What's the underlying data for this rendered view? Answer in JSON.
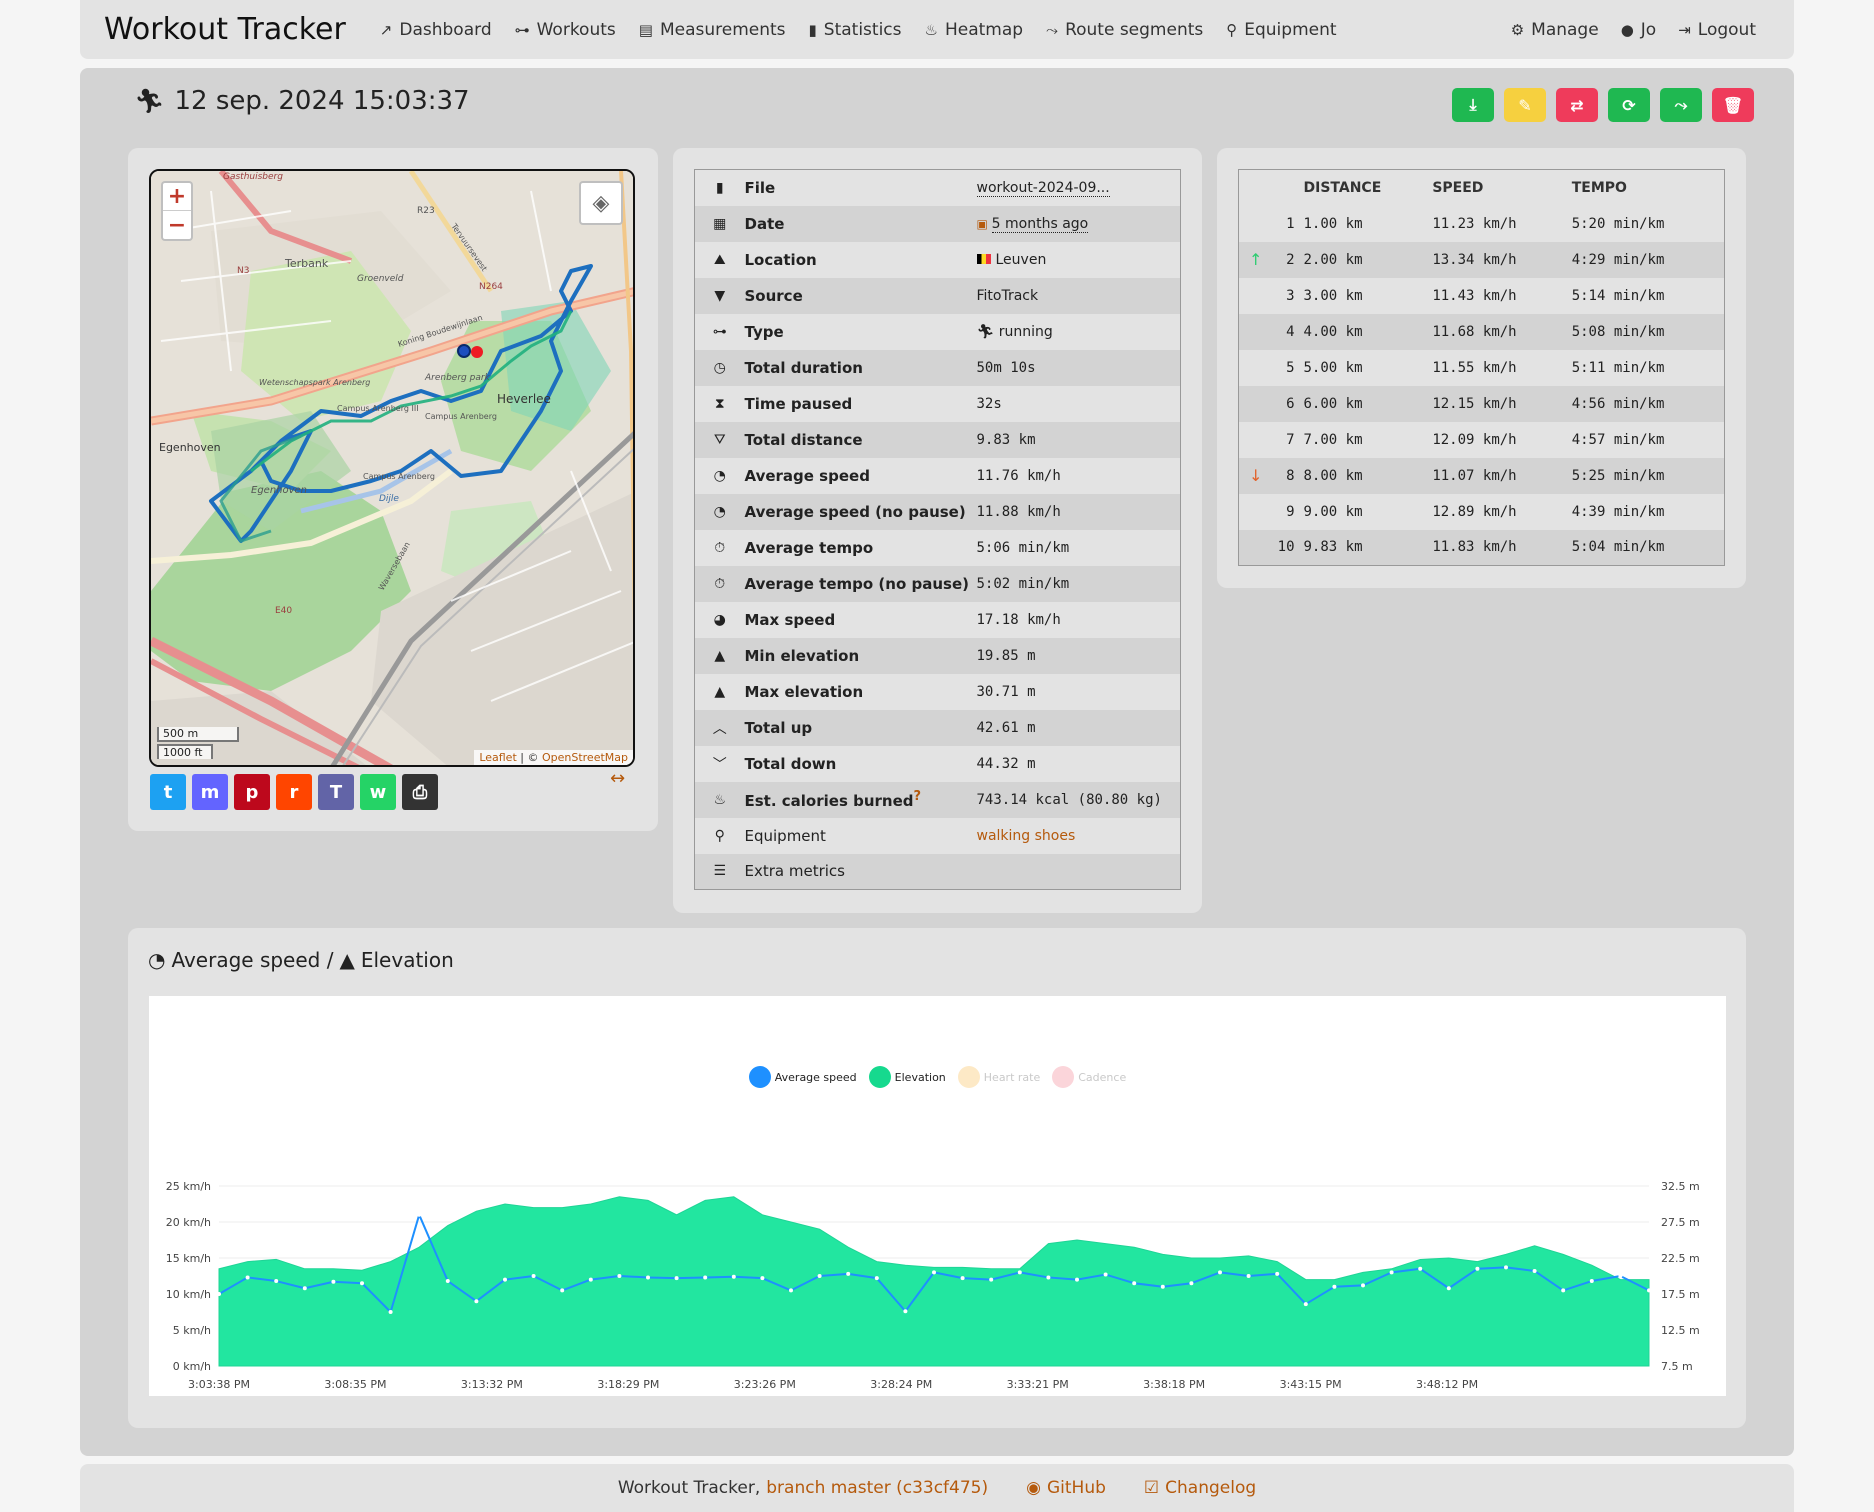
{
  "navbar": {
    "brand": "Workout Tracker",
    "items": [
      {
        "label": "Dashboard",
        "icon": "chart-line-icon"
      },
      {
        "label": "Workouts",
        "icon": "dumbbell-icon"
      },
      {
        "label": "Measurements",
        "icon": "weight-icon"
      },
      {
        "label": "Statistics",
        "icon": "bar-chart-icon"
      },
      {
        "label": "Heatmap",
        "icon": "fire-icon"
      },
      {
        "label": "Route segments",
        "icon": "route-icon"
      },
      {
        "label": "Equipment",
        "icon": "bicycle-icon"
      }
    ],
    "right": [
      {
        "label": "Manage",
        "icon": "gear-icon"
      },
      {
        "label": "Jo",
        "icon": "user-icon"
      },
      {
        "label": "Logout",
        "icon": "logout-icon"
      }
    ]
  },
  "workout": {
    "title": "12 sep. 2024 15:03:37",
    "actions": [
      {
        "name": "download",
        "color": "#1fb851"
      },
      {
        "name": "edit",
        "color": "#f6d03f"
      },
      {
        "name": "repeat",
        "color": "#ef3b5b"
      },
      {
        "name": "refresh",
        "color": "#1fb851"
      },
      {
        "name": "route-segment",
        "color": "#1fb851"
      },
      {
        "name": "delete",
        "color": "#ef3b5b"
      }
    ]
  },
  "map": {
    "zoom_in": "+",
    "zoom_out": "−",
    "scale_metric": "500 m",
    "scale_imperial": "1000 ft",
    "attribution_leaflet": "Leaflet",
    "attribution_sep": " | © ",
    "attribution_osm": "OpenStreetMap",
    "labels": [
      "Gasthuisberg",
      "Terbank",
      "Groenveld",
      "N3",
      "R23",
      "N264",
      "Tervuursevest",
      "Koning Boudewijnlaan",
      "Wetenschapspark Arenberg",
      "Arenberg park",
      "Campus Arenberg III",
      "Campus Arenberg",
      "Heverlee",
      "Egenhoven",
      "Egenhoven",
      "Campus Arenberg",
      "E40",
      "Waversebaan",
      "Dijle"
    ]
  },
  "share": [
    {
      "name": "twitter",
      "glyph": "t",
      "color": "#1da1f2"
    },
    {
      "name": "mastodon",
      "glyph": "m",
      "color": "#6364ff"
    },
    {
      "name": "pinterest",
      "glyph": "p",
      "color": "#bd081c"
    },
    {
      "name": "reddit",
      "glyph": "r",
      "color": "#ff4500"
    },
    {
      "name": "teams",
      "glyph": "T",
      "color": "#6264a7"
    },
    {
      "name": "whatsapp",
      "glyph": "w",
      "color": "#25d366"
    },
    {
      "name": "print",
      "glyph": "⎙",
      "color": "#333333"
    }
  ],
  "details": [
    {
      "icon": "file-icon",
      "label": "File",
      "value": "workout-2024-09...",
      "style": "dotted"
    },
    {
      "icon": "calendar-icon",
      "label": "Date",
      "value": "5 months ago",
      "prefix": "▣",
      "style": "dotted"
    },
    {
      "icon": "map-icon",
      "label": "Location",
      "value": "Leuven",
      "prefix": "flag"
    },
    {
      "icon": "bookmark-icon",
      "label": "Source",
      "value": "FitoTrack"
    },
    {
      "icon": "dumbbell-icon",
      "label": "Type",
      "value": "running",
      "prefix": "runner"
    },
    {
      "icon": "clock-icon",
      "label": "Total duration",
      "value": "50m 10s"
    },
    {
      "icon": "hourglass-icon",
      "label": "Time paused",
      "value": "32s"
    },
    {
      "icon": "road-icon",
      "label": "Total distance",
      "value": "9.83 km"
    },
    {
      "icon": "speedometer-icon",
      "label": "Average speed",
      "value": "11.76 km/h"
    },
    {
      "icon": "speedometer-icon",
      "label": "Average speed (no pause)",
      "value": "11.88 km/h"
    },
    {
      "icon": "stopwatch-icon",
      "label": "Average tempo",
      "value": "5:06 min/km"
    },
    {
      "icon": "stopwatch-icon",
      "label": "Average tempo (no pause)",
      "value": "5:02 min/km"
    },
    {
      "icon": "gauge-icon",
      "label": "Max speed",
      "value": "17.18 km/h"
    },
    {
      "icon": "mountain-icon",
      "label": "Min elevation",
      "value": "19.85 m"
    },
    {
      "icon": "mountain-icon",
      "label": "Max elevation",
      "value": "30.71 m"
    },
    {
      "icon": "chevron-up-icon",
      "label": "Total up",
      "value": "42.61 m"
    },
    {
      "icon": "chevron-down-icon",
      "label": "Total down",
      "value": "44.32 m"
    },
    {
      "icon": "fire-icon",
      "label": "Est. calories burned",
      "value": "743.14 kcal (80.80 kg)",
      "help": "?"
    },
    {
      "icon": "bicycle-icon",
      "label": "Equipment",
      "value": "walking shoes",
      "style": "link"
    },
    {
      "icon": "list-icon",
      "label": "Extra metrics",
      "value": "",
      "plain": true
    }
  ],
  "laps": {
    "headers": [
      "DISTANCE",
      "SPEED",
      "TEMPO"
    ],
    "rows": [
      {
        "n": "1",
        "mark": "",
        "distance": "1.00 km",
        "speed": "11.23 km/h",
        "tempo": "5:20 min/km"
      },
      {
        "n": "2",
        "mark": "↑",
        "distance": "2.00 km",
        "speed": "13.34 km/h",
        "tempo": "4:29 min/km"
      },
      {
        "n": "3",
        "mark": "",
        "distance": "3.00 km",
        "speed": "11.43 km/h",
        "tempo": "5:14 min/km"
      },
      {
        "n": "4",
        "mark": "",
        "distance": "4.00 km",
        "speed": "11.68 km/h",
        "tempo": "5:08 min/km"
      },
      {
        "n": "5",
        "mark": "",
        "distance": "5.00 km",
        "speed": "11.55 km/h",
        "tempo": "5:11 min/km"
      },
      {
        "n": "6",
        "mark": "",
        "distance": "6.00 km",
        "speed": "12.15 km/h",
        "tempo": "4:56 min/km"
      },
      {
        "n": "7",
        "mark": "",
        "distance": "7.00 km",
        "speed": "12.09 km/h",
        "tempo": "4:57 min/km"
      },
      {
        "n": "8",
        "mark": "↓",
        "distance": "8.00 km",
        "speed": "11.07 km/h",
        "tempo": "5:25 min/km"
      },
      {
        "n": "9",
        "mark": "",
        "distance": "9.00 km",
        "speed": "12.89 km/h",
        "tempo": "4:39 min/km"
      },
      {
        "n": "10",
        "mark": "",
        "distance": "9.83 km",
        "speed": "11.83 km/h",
        "tempo": "5:04 min/km"
      }
    ]
  },
  "chart_section": {
    "title_part1": "Average speed /",
    "title_part2": "Elevation"
  },
  "chart_data": {
    "type": "area",
    "legend": [
      {
        "name": "Average speed",
        "color": "#1e90ff",
        "active": true
      },
      {
        "name": "Elevation",
        "color": "#16d98e",
        "active": true
      },
      {
        "name": "Heart rate",
        "color": "#fde9c6",
        "active": false
      },
      {
        "name": "Cadence",
        "color": "#fbd5da",
        "active": false
      }
    ],
    "x_ticks": [
      "3:03:38 PM",
      "3:08:35 PM",
      "3:13:32 PM",
      "3:18:29 PM",
      "3:23:26 PM",
      "3:28:24 PM",
      "3:33:21 PM",
      "3:38:18 PM",
      "3:43:15 PM",
      "3:48:12 PM"
    ],
    "y_left_ticks": [
      "25 km/h",
      "20 km/h",
      "15 km/h",
      "10 km/h",
      "5 km/h",
      "0 km/h"
    ],
    "y_right_ticks": [
      "32.5 m",
      "27.5 m",
      "22.5 m",
      "17.5 m",
      "12.5 m",
      "7.5 m"
    ],
    "y_left_range": [
      0,
      25
    ],
    "y_right_range": [
      7.5,
      32.5
    ],
    "x_range": [
      0,
      50
    ],
    "series": [
      {
        "name": "Elevation",
        "color": "#22e6a0",
        "points": [
          [
            0,
            21
          ],
          [
            1,
            22
          ],
          [
            2,
            22.3
          ],
          [
            3,
            21
          ],
          [
            4,
            21
          ],
          [
            5,
            20.8
          ],
          [
            6,
            22
          ],
          [
            7,
            24
          ],
          [
            8,
            27
          ],
          [
            9,
            29
          ],
          [
            10,
            30
          ],
          [
            11,
            29.5
          ],
          [
            12,
            29.5
          ],
          [
            13,
            30
          ],
          [
            14,
            31
          ],
          [
            15,
            30.5
          ],
          [
            16,
            28.5
          ],
          [
            17,
            30.5
          ],
          [
            18,
            31
          ],
          [
            19,
            28.5
          ],
          [
            20,
            27.5
          ],
          [
            21,
            26.5
          ],
          [
            22,
            24
          ],
          [
            23,
            22
          ],
          [
            24,
            21.5
          ],
          [
            25,
            21.2
          ],
          [
            26,
            21.2
          ],
          [
            27,
            21
          ],
          [
            28,
            21
          ],
          [
            29,
            24.5
          ],
          [
            30,
            25
          ],
          [
            31,
            24.5
          ],
          [
            32,
            24
          ],
          [
            33,
            23
          ],
          [
            34,
            22.5
          ],
          [
            35,
            22.5
          ],
          [
            36,
            22.8
          ],
          [
            37,
            22
          ],
          [
            38,
            19.5
          ],
          [
            39,
            19.5
          ],
          [
            40,
            20.5
          ],
          [
            41,
            21
          ],
          [
            42,
            22.3
          ],
          [
            43,
            22.5
          ],
          [
            44,
            22
          ],
          [
            45,
            23
          ],
          [
            46,
            24.2
          ],
          [
            47,
            23
          ],
          [
            48,
            21.5
          ],
          [
            49,
            19.5
          ],
          [
            50,
            19.5
          ]
        ]
      },
      {
        "name": "Average speed",
        "color": "#1e90ff",
        "points": [
          [
            0,
            10
          ],
          [
            1,
            12.3
          ],
          [
            2,
            11.8
          ],
          [
            3,
            10.8
          ],
          [
            4,
            11.7
          ],
          [
            5,
            11.5
          ],
          [
            6,
            7.5
          ],
          [
            7,
            21
          ],
          [
            8,
            11.8
          ],
          [
            9,
            9
          ],
          [
            10,
            12
          ],
          [
            11,
            12.5
          ],
          [
            12,
            10.5
          ],
          [
            13,
            12
          ],
          [
            14,
            12.5
          ],
          [
            15,
            12.3
          ],
          [
            16,
            12.2
          ],
          [
            17,
            12.3
          ],
          [
            18,
            12.4
          ],
          [
            19,
            12.2
          ],
          [
            20,
            10.5
          ],
          [
            21,
            12.5
          ],
          [
            22,
            12.8
          ],
          [
            23,
            12.2
          ],
          [
            24,
            7.6
          ],
          [
            25,
            13
          ],
          [
            26,
            12.2
          ],
          [
            27,
            12
          ],
          [
            28,
            13
          ],
          [
            29,
            12.3
          ],
          [
            30,
            12
          ],
          [
            31,
            12.7
          ],
          [
            32,
            11.5
          ],
          [
            33,
            11
          ],
          [
            34,
            11.5
          ],
          [
            35,
            13
          ],
          [
            36,
            12.5
          ],
          [
            37,
            12.8
          ],
          [
            38,
            8.6
          ],
          [
            39,
            11
          ],
          [
            40,
            11.2
          ],
          [
            41,
            13
          ],
          [
            42,
            13.5
          ],
          [
            43,
            10.8
          ],
          [
            44,
            13.5
          ],
          [
            45,
            13.7
          ],
          [
            46,
            13.2
          ],
          [
            47,
            10.5
          ],
          [
            48,
            11.8
          ],
          [
            49,
            12.5
          ],
          [
            50,
            10.5
          ]
        ]
      }
    ]
  },
  "footer": {
    "prefix": "Workout Tracker,",
    "branch": "branch master (c33cf475)",
    "github": "GitHub",
    "changelog": "Changelog"
  }
}
